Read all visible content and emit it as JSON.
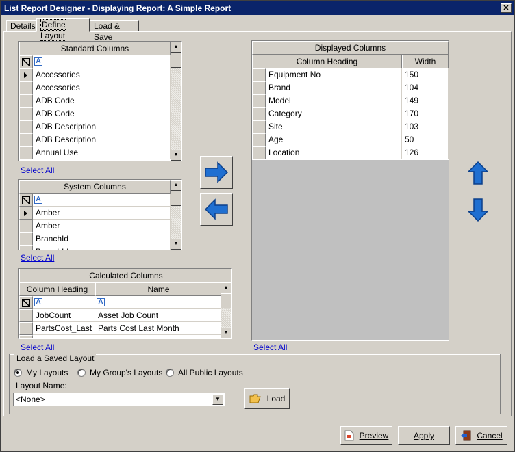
{
  "window": {
    "title": "List Report Designer - Displaying Report: A Simple Report",
    "close_glyph": "✕"
  },
  "tabs": [
    "Details",
    "Define Layout",
    "Load & Save"
  ],
  "active_tab": "Define Layout",
  "standard_columns": {
    "title": "Standard Columns",
    "rows": [
      "Accessories",
      "Accessories",
      "ADB Code",
      "ADB Code",
      "ADB Description",
      "ADB Description",
      "Annual Use"
    ],
    "select_all": "Select All"
  },
  "system_columns": {
    "title": "System Columns",
    "rows": [
      "Amber",
      "Amber",
      "BranchId",
      "BranchId"
    ],
    "select_all": "Select All"
  },
  "calculated_columns": {
    "title": "Calculated Columns",
    "headers": [
      "Column Heading",
      "Name"
    ],
    "rows": [
      [
        "JobCount",
        "Asset Job Count"
      ],
      [
        "PartsCost_Last",
        "Parts Cost Last Month"
      ],
      [
        "PPMCount_Last",
        "PPM Job Last Month"
      ]
    ],
    "select_all": "Select All"
  },
  "displayed_columns": {
    "title": "Displayed Columns",
    "headers": [
      "Column Heading",
      "Width"
    ],
    "rows": [
      [
        "Equipment No",
        "150"
      ],
      [
        "Brand",
        "104"
      ],
      [
        "Model",
        "149"
      ],
      [
        "Category",
        "170"
      ],
      [
        "Site",
        "103"
      ],
      [
        "Age",
        "50"
      ],
      [
        "Location",
        "126"
      ]
    ],
    "select_all": "Select All"
  },
  "load_layout": {
    "legend": "Load a Saved Layout",
    "options": [
      "My Layouts",
      "My Group's Layouts",
      "All Public Layouts"
    ],
    "selected": "My Layouts",
    "layout_name_label": "Layout Name:",
    "layout_name_value": "<None>",
    "load_button": "Load"
  },
  "footer": {
    "preview": "Preview",
    "apply": "Apply",
    "cancel": "Cancel"
  },
  "colors": {
    "titlebar": "#0a246a",
    "arrow_blue": "#1f6fd1",
    "link": "#0000cc"
  }
}
